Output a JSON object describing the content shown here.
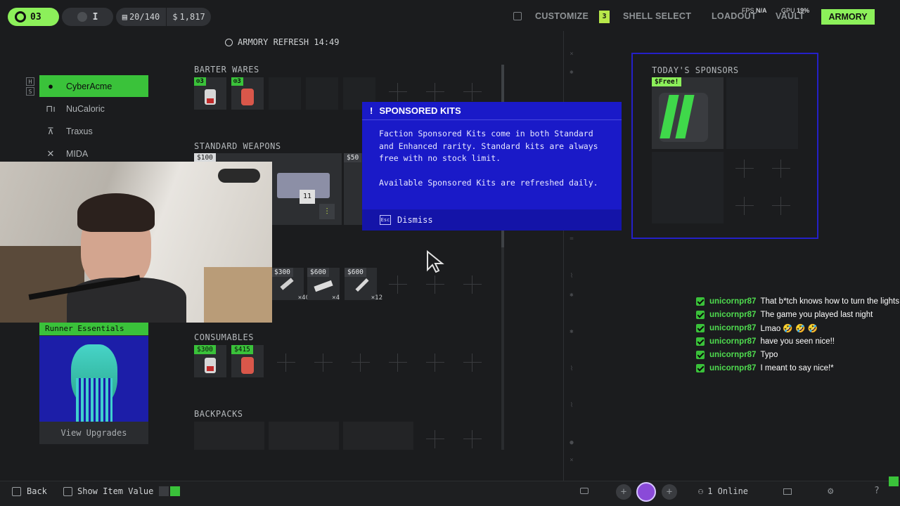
{
  "colors": {
    "accent": "#8cf05a",
    "modal": "#1a1ac8",
    "highlight": "#3ac23a",
    "sponsor_border": "#2420c8"
  },
  "topbar": {
    "level": "03",
    "rank_label": "I",
    "capacity": "20/140",
    "credits": "1,817",
    "nav": [
      {
        "label": "CUSTOMIZE",
        "badge": "3"
      },
      {
        "label": "SHELL SELECT"
      },
      {
        "label": "LOADOUT"
      },
      {
        "label": "VAULT"
      },
      {
        "label": "ARMORY"
      }
    ],
    "perf": {
      "fps_label": "FPS",
      "fps": "N/A",
      "gpu_label": "GPU",
      "gpu": "19%"
    }
  },
  "armory_refresh": "ARMORY REFRESH 14:49",
  "factions": [
    {
      "name": "CyberAcme",
      "icon": "cyberacme-icon",
      "active": true
    },
    {
      "name": "NuCaloric",
      "icon": "nucaloric-icon"
    },
    {
      "name": "Traxus",
      "icon": "traxus-icon"
    },
    {
      "name": "MIDA",
      "icon": "mida-icon"
    }
  ],
  "faction_keys": [
    "H",
    "S"
  ],
  "sections": {
    "barter": {
      "title": "BARTER WARES",
      "items": [
        {
          "tag": "3"
        },
        {
          "tag": "3"
        }
      ]
    },
    "standard": {
      "title": "STANDARD WEAPONS",
      "prices": [
        "100",
        "50"
      ],
      "level": "11"
    },
    "ammo": {
      "items": [
        {
          "price": "300",
          "qty": "×40"
        },
        {
          "price": "600",
          "qty": "×4"
        },
        {
          "price": "600",
          "qty": "×12"
        }
      ]
    },
    "consumables": {
      "title": "CONSUMABLES",
      "items": [
        {
          "price": "300"
        },
        {
          "price": "415"
        }
      ]
    },
    "backpacks": {
      "title": "BACKPACKS"
    }
  },
  "modal": {
    "title": "SPONSORED KITS",
    "body1": "Faction Sponsored Kits come in both Standard and Enhanced rarity. Standard kits are always free with no stock limit.",
    "body2": "Available Sponsored Kits are refreshed daily.",
    "key": "Esc",
    "dismiss": "Dismiss"
  },
  "sponsors": {
    "title": "TODAY'S SPONSORS",
    "free_label": "Free!"
  },
  "upgrades": {
    "title": "Runner Essentials",
    "button": "View Upgrades"
  },
  "chat": [
    {
      "user": "unicornpr87",
      "msg": "That b*tch knows how to turn the lights on"
    },
    {
      "user": "unicornpr87",
      "msg": "The game you played last night"
    },
    {
      "user": "unicornpr87",
      "msg": "Lmao 🤣 🤣 🤣"
    },
    {
      "user": "unicornpr87",
      "msg": "have you seen nice!!"
    },
    {
      "user": "unicornpr87",
      "msg": "Typo"
    },
    {
      "user": "unicornpr87",
      "msg": "I meant to say nice!*"
    }
  ],
  "bottombar": {
    "back": "Back",
    "show_value": "Show Item Value",
    "online": "1 Online"
  }
}
